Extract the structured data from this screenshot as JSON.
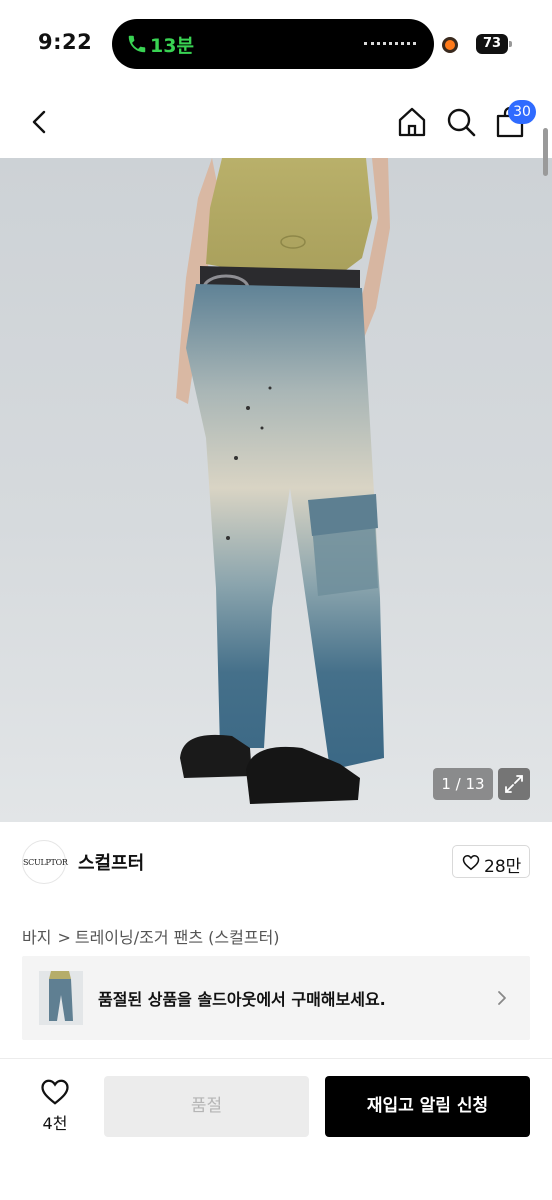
{
  "status_bar": {
    "time": "9:22",
    "call_duration": "13분",
    "battery": "73"
  },
  "header": {
    "back_icon": "chevron-left-icon",
    "home_icon": "home-icon",
    "search_icon": "search-icon",
    "cart_icon": "shopping-bag-icon",
    "cart_count": "30"
  },
  "gallery": {
    "counter": "1 / 13",
    "expand_icon": "expand-icon"
  },
  "brand": {
    "logo_text": "SCULPTOR",
    "name": "스컬프터",
    "like_count": "28만"
  },
  "breadcrumb": {
    "category": "바지",
    "separator": ">",
    "subcategory": "트레이닝/조거 팬츠 (스컬프터)"
  },
  "banner": {
    "text": "품절된 상품을 솔드아웃에서 구매해보세요.",
    "chevron_icon": "chevron-right-icon"
  },
  "bottom_bar": {
    "like_count": "4천",
    "soldout_label": "품절",
    "notify_label": "재입고 알림 신청"
  },
  "colors": {
    "badge": "#2f6bff",
    "call_green": "#39d353",
    "primary_button": "#000000",
    "disabled_button": "#ececec"
  }
}
